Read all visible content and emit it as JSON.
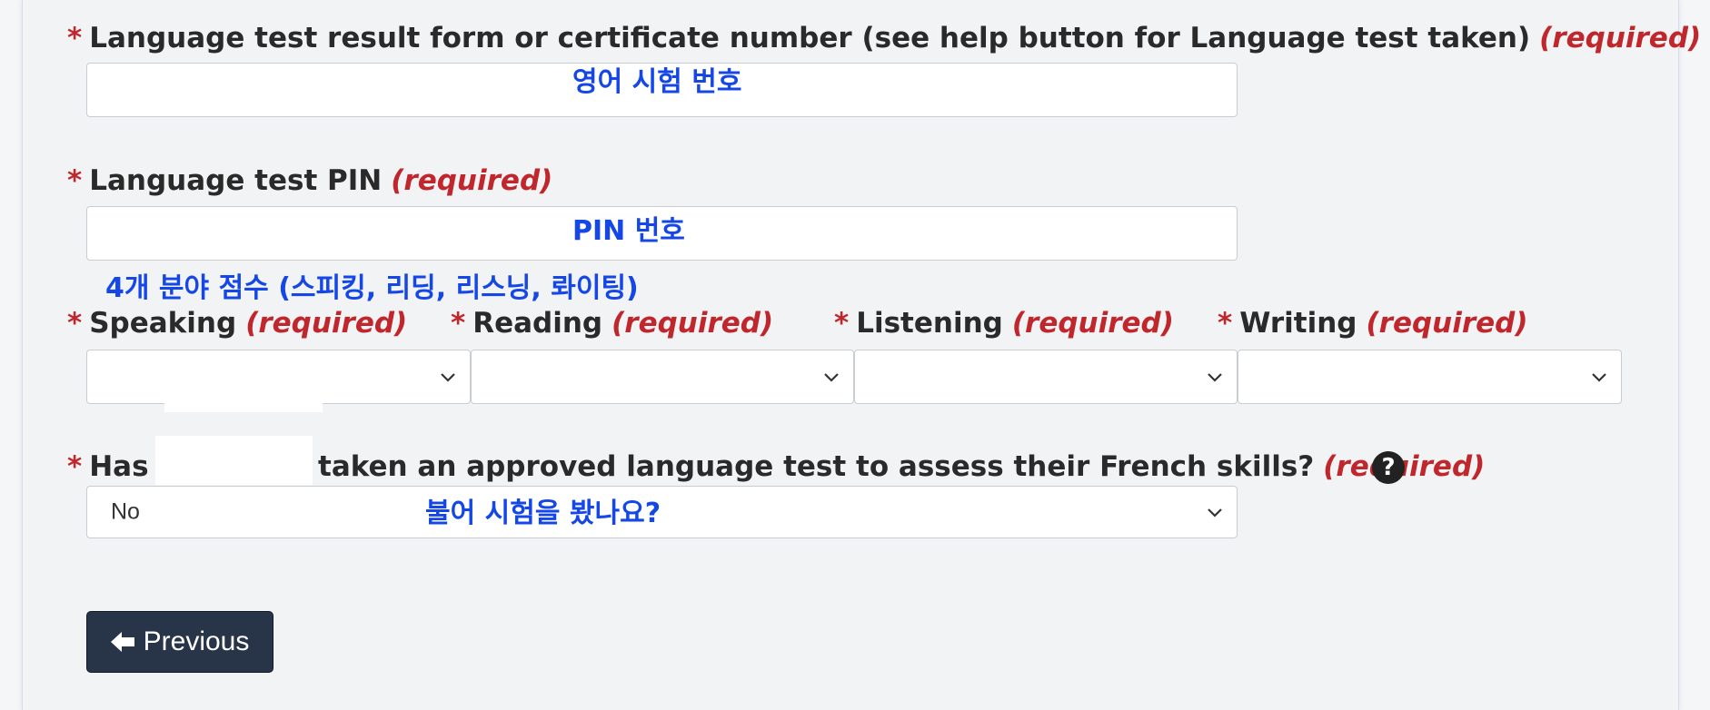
{
  "form": {
    "certificate": {
      "star": "*",
      "label": "Language test result form or certificate number (see help button for Language test taken)",
      "required": "(required)",
      "annotation": "영어 시험 번호",
      "value": ""
    },
    "pin": {
      "star": "*",
      "label": "Language test PIN",
      "required": "(required)",
      "annotation": "PIN 번호",
      "value": ""
    },
    "scores_annotation": "4개 분야 점수 (스피킹, 리딩, 리스닝, 롸이팅)",
    "scores": [
      {
        "star": "*",
        "label": "Speaking",
        "required": "(required)",
        "value": ""
      },
      {
        "star": "*",
        "label": "Reading",
        "required": "(required)",
        "value": ""
      },
      {
        "star": "*",
        "label": "Listening",
        "required": "(required)",
        "value": ""
      },
      {
        "star": "*",
        "label": "Writing",
        "required": "(required)",
        "value": ""
      }
    ],
    "french": {
      "star": "*",
      "label_start": "Has",
      "label_end": "taken an approved language test to assess their French skills?",
      "required": "(required)",
      "help_glyph": "?",
      "value": "No",
      "annotation": "불어 시험을 봤나요?"
    }
  },
  "buttons": {
    "previous_label": "Previous",
    "previous_icon": "arrow-left-icon"
  },
  "colors": {
    "required_red": "#c0272d",
    "annotation_blue": "#1447e6",
    "button_bg": "#283548"
  }
}
